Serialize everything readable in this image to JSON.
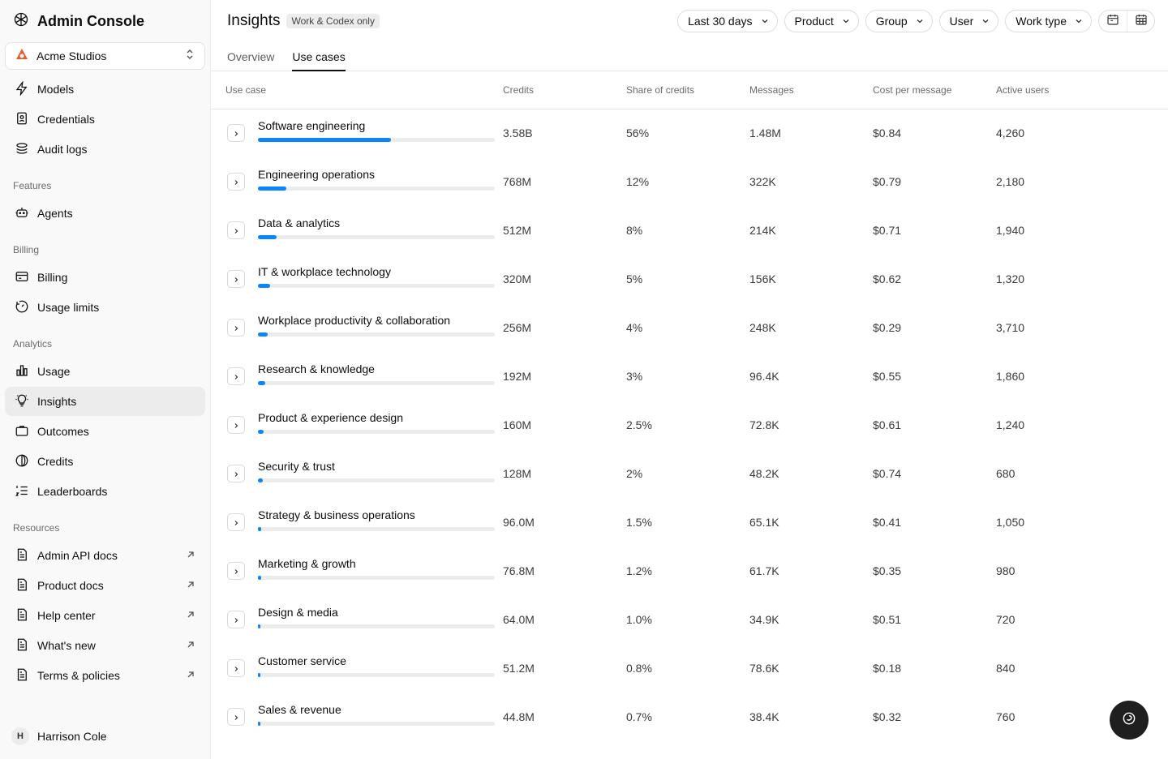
{
  "sidebar": {
    "brand": "Admin Console",
    "org": "Acme Studios",
    "top_items": [
      {
        "label": "Models"
      },
      {
        "label": "Credentials"
      },
      {
        "label": "Audit logs"
      }
    ],
    "sections": {
      "features": "Features",
      "billing": "Billing",
      "analytics": "Analytics",
      "resources": "Resources"
    },
    "features_items": [
      {
        "label": "Agents"
      }
    ],
    "billing_items": [
      {
        "label": "Billing"
      },
      {
        "label": "Usage limits"
      }
    ],
    "analytics_items": [
      {
        "label": "Usage"
      },
      {
        "label": "Insights"
      },
      {
        "label": "Outcomes"
      },
      {
        "label": "Credits"
      },
      {
        "label": "Leaderboards"
      }
    ],
    "resources_items": [
      {
        "label": "Admin API docs"
      },
      {
        "label": "Product docs"
      },
      {
        "label": "Help center"
      },
      {
        "label": "What's new"
      },
      {
        "label": "Terms & policies"
      }
    ],
    "user": {
      "initial": "H",
      "name": "Harrison Cole"
    }
  },
  "header": {
    "title": "Insights",
    "badge": "Work & Codex only",
    "filters": [
      "Last 30 days",
      "Product",
      "Group",
      "User",
      "Work type"
    ]
  },
  "tabs": [
    {
      "label": "Overview"
    },
    {
      "label": "Use cases"
    }
  ],
  "table": {
    "columns": [
      "Use case",
      "Credits",
      "Share of credits",
      "Messages",
      "Cost per message",
      "Active users"
    ],
    "rows": [
      {
        "name": "Software engineering",
        "credits": "3.58B",
        "share": "56%",
        "share_value": 56,
        "messages": "1.48M",
        "cost": "$0.84",
        "users": "4,260"
      },
      {
        "name": "Engineering operations",
        "credits": "768M",
        "share": "12%",
        "share_value": 12,
        "messages": "322K",
        "cost": "$0.79",
        "users": "2,180"
      },
      {
        "name": "Data & analytics",
        "credits": "512M",
        "share": "8%",
        "share_value": 8,
        "messages": "214K",
        "cost": "$0.71",
        "users": "1,940"
      },
      {
        "name": "IT & workplace technology",
        "credits": "320M",
        "share": "5%",
        "share_value": 5,
        "messages": "156K",
        "cost": "$0.62",
        "users": "1,320"
      },
      {
        "name": "Workplace productivity & collaboration",
        "credits": "256M",
        "share": "4%",
        "share_value": 4,
        "messages": "248K",
        "cost": "$0.29",
        "users": "3,710"
      },
      {
        "name": "Research & knowledge",
        "credits": "192M",
        "share": "3%",
        "share_value": 3,
        "messages": "96.4K",
        "cost": "$0.55",
        "users": "1,860"
      },
      {
        "name": "Product & experience design",
        "credits": "160M",
        "share": "2.5%",
        "share_value": 2.5,
        "messages": "72.8K",
        "cost": "$0.61",
        "users": "1,240"
      },
      {
        "name": "Security & trust",
        "credits": "128M",
        "share": "2%",
        "share_value": 2,
        "messages": "48.2K",
        "cost": "$0.74",
        "users": "680"
      },
      {
        "name": "Strategy & business operations",
        "credits": "96.0M",
        "share": "1.5%",
        "share_value": 1.5,
        "messages": "65.1K",
        "cost": "$0.41",
        "users": "1,050"
      },
      {
        "name": "Marketing & growth",
        "credits": "76.8M",
        "share": "1.2%",
        "share_value": 1.2,
        "messages": "61.7K",
        "cost": "$0.35",
        "users": "980"
      },
      {
        "name": "Design & media",
        "credits": "64.0M",
        "share": "1.0%",
        "share_value": 1.0,
        "messages": "34.9K",
        "cost": "$0.51",
        "users": "720"
      },
      {
        "name": "Customer service",
        "credits": "51.2M",
        "share": "0.8%",
        "share_value": 0.8,
        "messages": "78.6K",
        "cost": "$0.18",
        "users": "840"
      },
      {
        "name": "Sales & revenue",
        "credits": "44.8M",
        "share": "0.7%",
        "share_value": 0.7,
        "messages": "38.4K",
        "cost": "$0.32",
        "users": "760"
      }
    ]
  },
  "colors": {
    "accent": "#0a84ff",
    "bar_track": "#ececec",
    "active_nav": "#ececec"
  }
}
